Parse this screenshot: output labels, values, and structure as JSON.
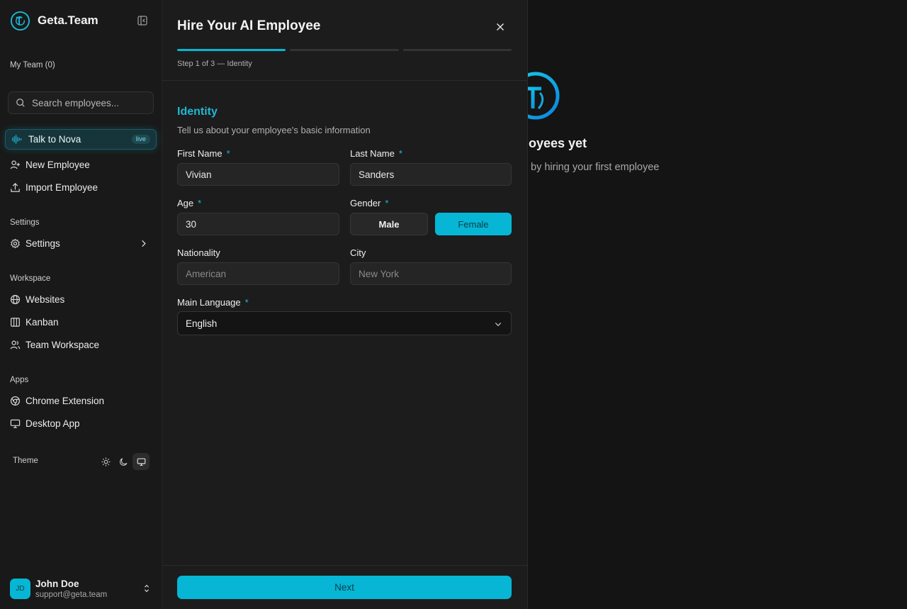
{
  "sidebar": {
    "brand_name": "Geta.Team",
    "my_team_label": "My Team (0)",
    "search_placeholder": "Search employees...",
    "nova": {
      "label": "Talk to Nova",
      "badge": "live"
    },
    "actions": [
      {
        "label": "New Employee",
        "icon": "user-plus-icon"
      },
      {
        "label": "Import Employee",
        "icon": "upload-icon"
      }
    ],
    "settings_section": "Settings",
    "settings_item": "Settings",
    "workspace_section": "Workspace",
    "workspace_items": [
      {
        "label": "Websites",
        "icon": "globe-icon"
      },
      {
        "label": "Kanban",
        "icon": "kanban-icon"
      },
      {
        "label": "Team Workspace",
        "icon": "users-icon"
      }
    ],
    "apps_section": "Apps",
    "apps_items": [
      {
        "label": "Chrome Extension",
        "icon": "chrome-icon"
      },
      {
        "label": "Desktop App",
        "icon": "monitor-icon"
      }
    ],
    "theme_label": "Theme",
    "theme_selected": "system",
    "user": {
      "initials": "JD",
      "name": "John Doe",
      "email": "support@geta.team"
    }
  },
  "background": {
    "empty_title": "loyees yet",
    "empty_subtitle": "by hiring your first employee"
  },
  "modal": {
    "title": "Hire Your AI Employee",
    "progress": {
      "current_step": 1,
      "total_steps": 3
    },
    "step_text": "Step 1 of 3 — Identity",
    "section_title": "Identity",
    "section_desc": "Tell us about your employee's basic information",
    "fields": {
      "first_name": {
        "label": "First Name",
        "value": "Vivian"
      },
      "last_name": {
        "label": "Last Name",
        "value": "Sanders"
      },
      "age": {
        "label": "Age",
        "value": "30"
      },
      "gender": {
        "label": "Gender",
        "options": [
          "Male",
          "Female"
        ],
        "selected": "Female"
      },
      "nationality": {
        "label": "Nationality",
        "placeholder": "American"
      },
      "city": {
        "label": "City",
        "placeholder": "New York"
      },
      "main_language": {
        "label": "Main Language",
        "value": "English"
      }
    },
    "required_marker": "*",
    "next_label": "Next"
  },
  "colors": {
    "accent": "#06b6d4",
    "background": "#141414",
    "panel": "#1c1c1c"
  }
}
